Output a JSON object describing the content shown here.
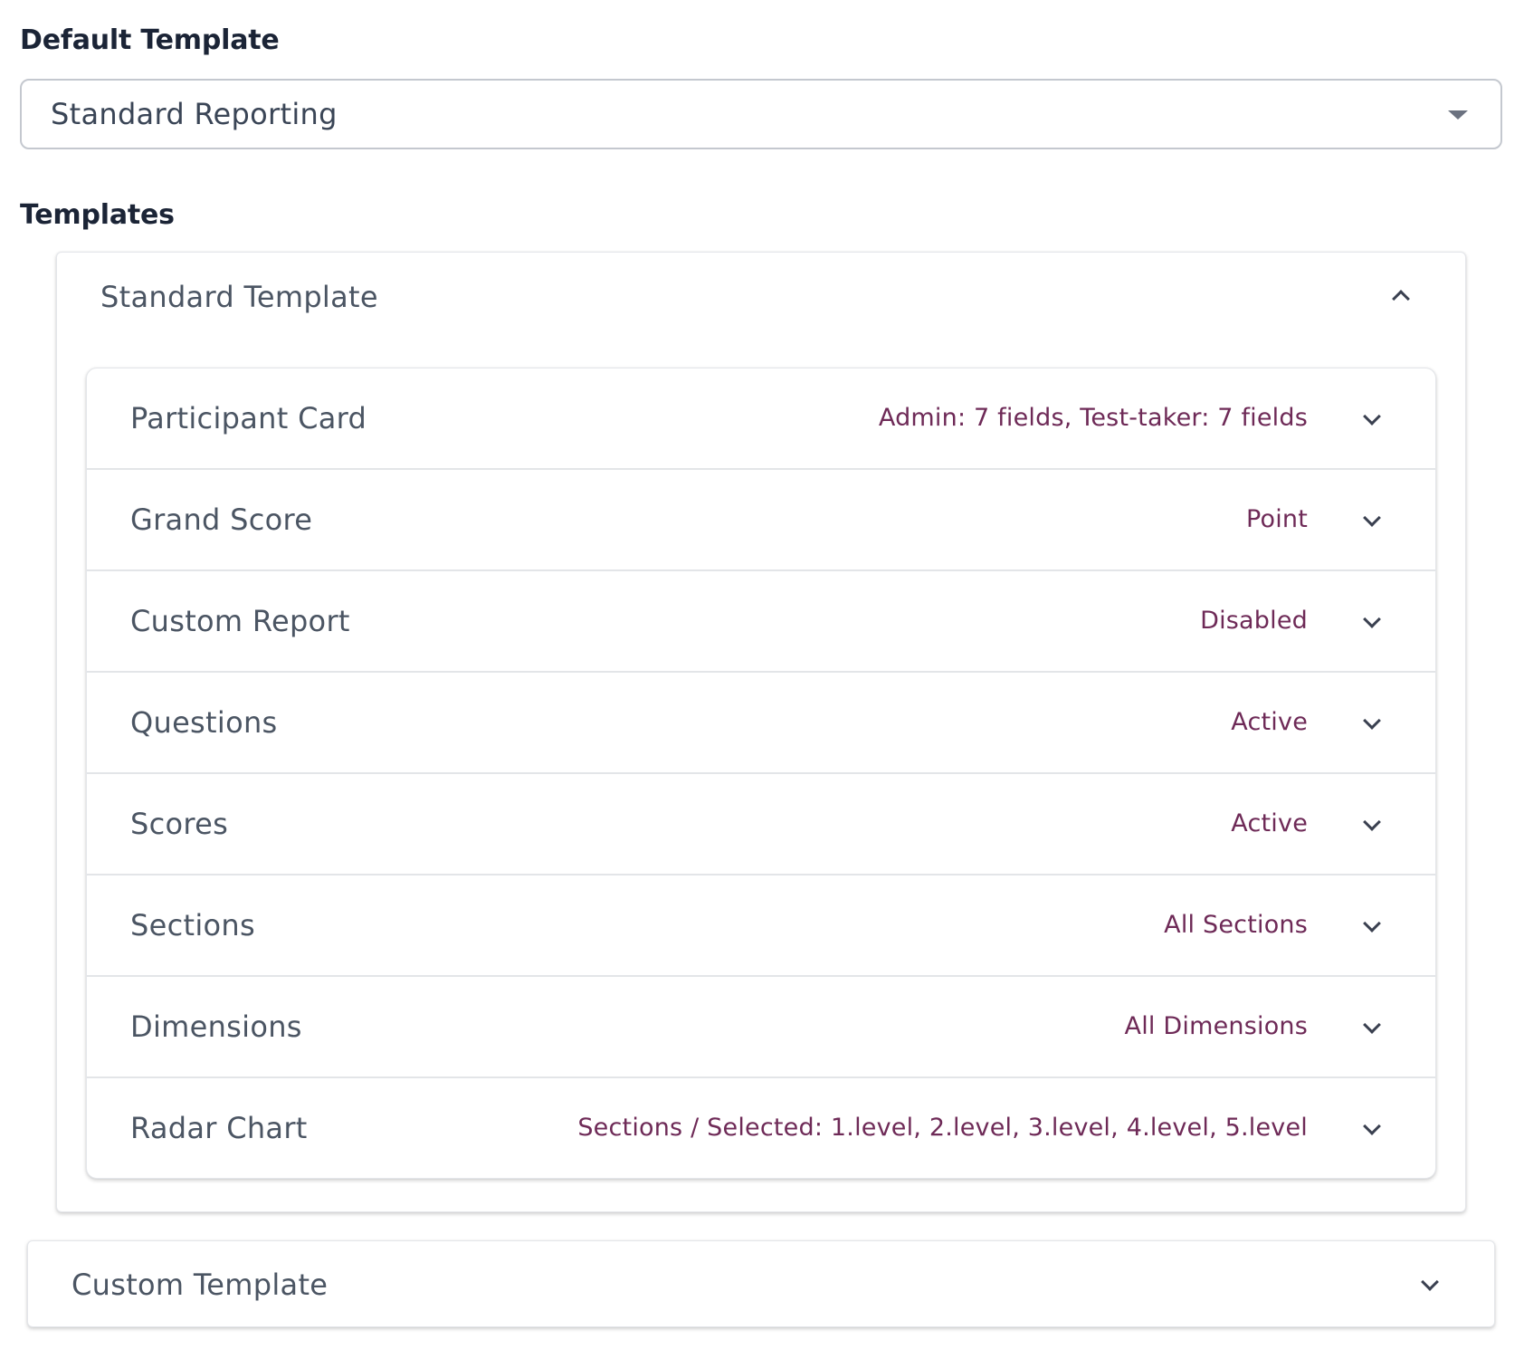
{
  "default_template": {
    "heading": "Default Template",
    "selected": "Standard Reporting",
    "caret_icon": "caret-down-icon"
  },
  "templates": {
    "heading": "Templates",
    "standard": {
      "title": "Standard Template",
      "expanded": true,
      "chevron_icon": "chevron-up-icon",
      "sections": [
        {
          "label": "Participant Card",
          "summary": "Admin: 7 fields, Test-taker: 7 fields"
        },
        {
          "label": "Grand Score",
          "summary": "Point"
        },
        {
          "label": "Custom Report",
          "summary": "Disabled"
        },
        {
          "label": "Questions",
          "summary": "Active"
        },
        {
          "label": "Scores",
          "summary": "Active"
        },
        {
          "label": "Sections",
          "summary": "All Sections"
        },
        {
          "label": "Dimensions",
          "summary": "All Dimensions"
        },
        {
          "label": "Radar Chart",
          "summary": "Sections / Selected: 1.level, 2.level, 3.level, 4.level, 5.level"
        }
      ]
    },
    "custom": {
      "title": "Custom Template",
      "expanded": false,
      "chevron_icon": "chevron-down-icon"
    }
  },
  "colors": {
    "heading": "#1b2436",
    "label": "#4b5563",
    "summary": "#6e2a57",
    "border": "#c4c8cf"
  }
}
